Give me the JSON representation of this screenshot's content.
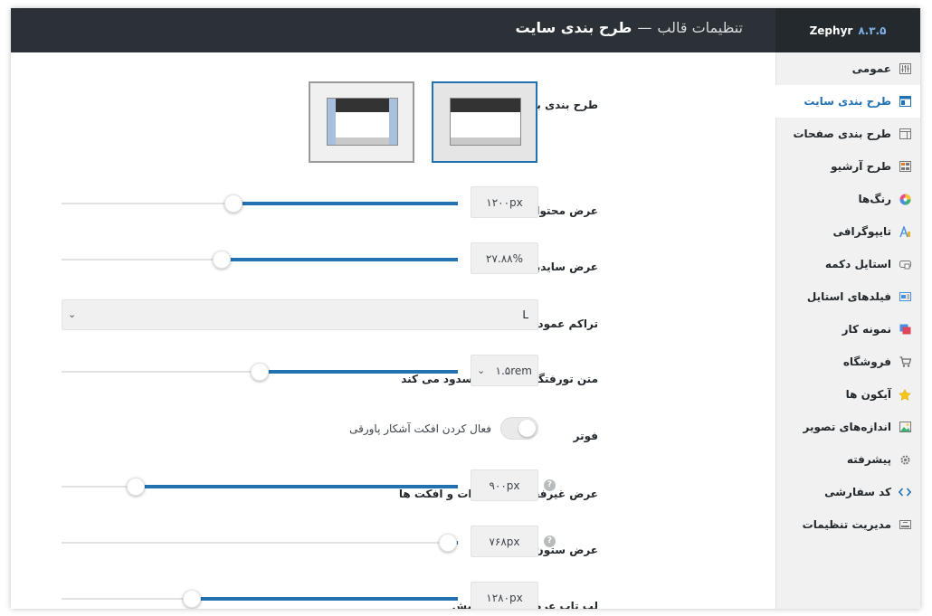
{
  "header": {
    "brand_name": "Zephyr",
    "brand_version": "۸.۳.۵",
    "title_section": "تنظیمات قالب",
    "title_separator": "—",
    "title_page": "طرح بندی سایت"
  },
  "sidebar": {
    "items": [
      {
        "label": "عمومی",
        "icon": "sliders-icon"
      },
      {
        "label": "طرح بندی سایت",
        "icon": "layout-icon",
        "active": true
      },
      {
        "label": "طرح بندی صفحات",
        "icon": "page-layout-icon"
      },
      {
        "label": "طرح آرشیو",
        "icon": "archive-icon"
      },
      {
        "label": "رنگ‌ها",
        "icon": "color-wheel-icon"
      },
      {
        "label": "تایپوگرافی",
        "icon": "typography-icon"
      },
      {
        "label": "استایل دکمه",
        "icon": "button-style-icon"
      },
      {
        "label": "فیلدهای استایل",
        "icon": "fields-icon"
      },
      {
        "label": "نمونه کار",
        "icon": "portfolio-icon"
      },
      {
        "label": "فروشگاه",
        "icon": "cart-icon"
      },
      {
        "label": "آیکون ها",
        "icon": "star-icon"
      },
      {
        "label": "اندازه‌های تصویر",
        "icon": "image-sizes-icon"
      },
      {
        "label": "پیشرفته",
        "icon": "gear-icon"
      },
      {
        "label": "کد سفارشی",
        "icon": "code-icon"
      },
      {
        "label": "مدیریت تنظیمات",
        "icon": "settings-manager-icon"
      }
    ]
  },
  "settings": {
    "canvas_layout": {
      "label": "طرح بندی بوم سایت",
      "options": [
        "full-width",
        "boxed"
      ],
      "selected": "full-width"
    },
    "content_width": {
      "label": "عرض محتوای سایت",
      "value": "۱۲۰۰px",
      "level": 0.57
    },
    "sidebar_width": {
      "label": "عرض سایدبار",
      "value": "۲۷.۸۸%",
      "level": 0.6
    },
    "column_stacking": {
      "label": "تراکم عمودی ردیف به طور پیش فرض",
      "value": "L"
    },
    "bottom_padding": {
      "label": "متن تورفتگی پایین را مسدود می کند",
      "value": "۱.۵rem",
      "level": 0.5
    },
    "footer": {
      "label": "فوتر",
      "toggle_text": "فعال کردن افکت آشکار پاورقی",
      "enabled": false
    },
    "effects_disable_width": {
      "label": "عرض غیرفعال شدن اثرات و افکت ها",
      "value": "۹۰۰px",
      "level": 0.83
    },
    "columns_width": {
      "label": "عرض ستون ها",
      "value": "۷۶۸px",
      "level": 0.0
    },
    "laptop_width": {
      "label": "لپ تاپ عرض صفحه نمایش",
      "value": "۱۲۸۰px",
      "level": 0.68
    }
  },
  "colors": {
    "accent": "#2271b1",
    "header_bg": "#2b3136",
    "sidebar_bg": "#f1f1f1"
  }
}
